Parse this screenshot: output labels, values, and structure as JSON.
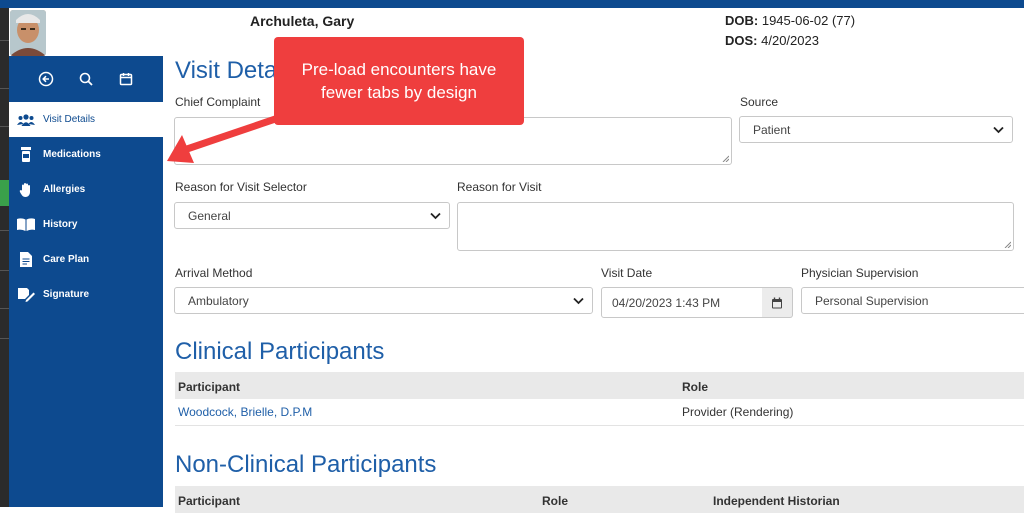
{
  "patient": {
    "name": "Archuleta, Gary",
    "dob_label": "DOB:",
    "dob_value": "1945-06-02 (77)",
    "dos_label": "DOS:",
    "dos_value": "4/20/2023"
  },
  "sidebar": {
    "items": [
      {
        "label": "Visit Details",
        "icon": "people-icon"
      },
      {
        "label": "Medications",
        "icon": "pill-bottle-icon"
      },
      {
        "label": "Allergies",
        "icon": "hand-icon"
      },
      {
        "label": "History",
        "icon": "book-icon"
      },
      {
        "label": "Care Plan",
        "icon": "document-icon"
      },
      {
        "label": "Signature",
        "icon": "signature-icon"
      }
    ]
  },
  "main": {
    "title": "Visit Deta",
    "chief_complaint_label": "Chief Complaint",
    "source_label": "Source",
    "source_value": "Patient",
    "reason_selector_label": "Reason for Visit Selector",
    "reason_selector_value": "General",
    "reason_label": "Reason for Visit",
    "arrival_label": "Arrival Method",
    "arrival_value": "Ambulatory",
    "visit_date_label": "Visit Date",
    "visit_date_value": "04/20/2023 1:43 PM",
    "physician_label": "Physician Supervision",
    "physician_value": "Personal Supervision"
  },
  "clinical": {
    "title": "Clinical Participants",
    "headers": [
      "Participant",
      "Role"
    ],
    "rows": [
      {
        "participant": "Woodcock, Brielle, D.P.M",
        "role": "Provider (Rendering)"
      }
    ]
  },
  "nonclinical": {
    "title": "Non-Clinical Participants",
    "headers": [
      "Participant",
      "Role",
      "Independent Historian"
    ]
  },
  "callout": {
    "line1": "Pre-load encounters have",
    "line2": "fewer tabs by design"
  },
  "colors": {
    "brand_blue": "#0d4a8f",
    "heading_blue": "#1f5fa8",
    "callout_red": "#ef3e3e"
  }
}
